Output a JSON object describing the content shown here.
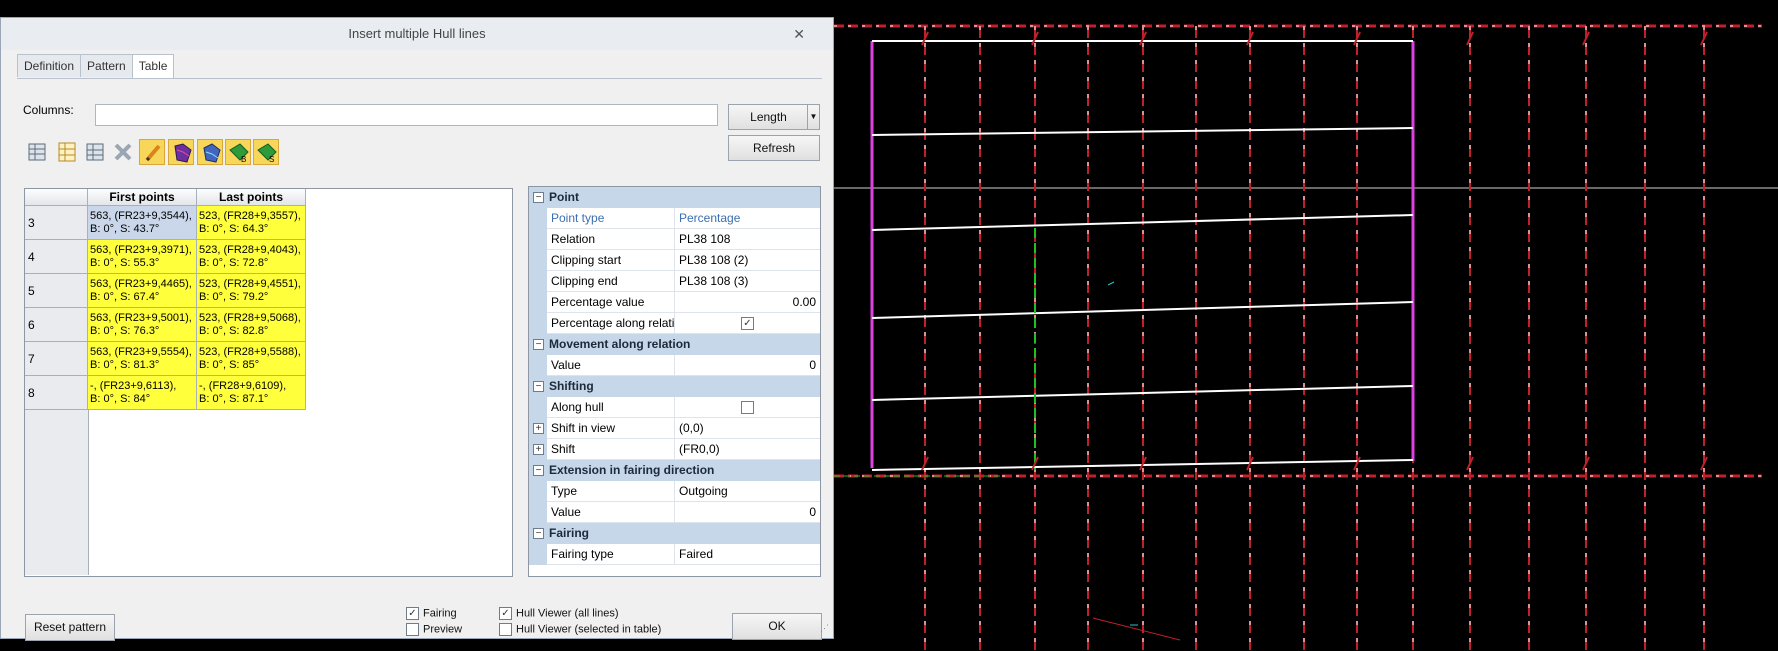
{
  "window": {
    "title": "Insert multiple Hull lines"
  },
  "tabs": [
    "Definition",
    "Pattern",
    "Table"
  ],
  "columns": {
    "label": "Columns:",
    "value": ""
  },
  "buttons": {
    "length": "Length",
    "refresh": "Refresh",
    "reset": "Reset pattern",
    "ok": "OK"
  },
  "toolbar_icons": [
    "insert-rows-icon",
    "insert-columns-icon",
    "delete-rows-icon",
    "delete-icon",
    "edit-pencil-icon",
    "hull-view-icon",
    "hull-view-alt-icon",
    "export-b-icon",
    "export-s-icon"
  ],
  "grid": {
    "headers": [
      "First points",
      "Last points"
    ],
    "rows": [
      {
        "id": "3",
        "first": [
          "563, (FR23+9,3544),",
          "B: 0°, S: 43.7°"
        ],
        "last": [
          "523, (FR28+9,3557),",
          "B: 0°, S: 64.3°"
        ]
      },
      {
        "id": "4",
        "first": [
          "563, (FR23+9,3971),",
          "B: 0°, S: 55.3°"
        ],
        "last": [
          "523, (FR28+9,4043),",
          "B: 0°, S: 72.8°"
        ]
      },
      {
        "id": "5",
        "first": [
          "563, (FR23+9,4465),",
          "B: 0°, S: 67.4°"
        ],
        "last": [
          "523, (FR28+9,4551),",
          "B: 0°, S: 79.2°"
        ]
      },
      {
        "id": "6",
        "first": [
          "563, (FR23+9,5001),",
          "B: 0°, S: 76.3°"
        ],
        "last": [
          "523, (FR28+9,5068),",
          "B: 0°, S: 82.8°"
        ]
      },
      {
        "id": "7",
        "first": [
          "563, (FR23+9,5554),",
          "B: 0°, S: 81.3°"
        ],
        "last": [
          "523, (FR28+9,5588),",
          "B: 0°, S: 85°"
        ]
      },
      {
        "id": "8",
        "first": [
          "-, (FR23+9,6113),",
          "B: 0°, S: 84°"
        ],
        "last": [
          "-, (FR28+9,6109),",
          "B: 0°, S: 87.1°"
        ]
      }
    ]
  },
  "properties": [
    {
      "type": "section",
      "label": "Point",
      "sign": "⊟"
    },
    {
      "type": "prop",
      "name": "Point type",
      "value": "Percentage",
      "style": "blue"
    },
    {
      "type": "prop",
      "name": "Relation",
      "value": "PL38 108"
    },
    {
      "type": "prop",
      "name": "Clipping start",
      "value": "PL38 108 (2)"
    },
    {
      "type": "prop",
      "name": "Clipping end",
      "value": "PL38 108 (3)"
    },
    {
      "type": "prop",
      "name": "Percentage value",
      "value": "0.00",
      "align": "num"
    },
    {
      "type": "check",
      "name": "Percentage along relatio",
      "checked": true
    },
    {
      "type": "section",
      "label": "Movement along relation",
      "sign": "⊟"
    },
    {
      "type": "prop",
      "name": "Value",
      "value": "0",
      "align": "num"
    },
    {
      "type": "section",
      "label": "Shifting",
      "sign": "⊟"
    },
    {
      "type": "check",
      "name": "Along hull",
      "checked": false
    },
    {
      "type": "prop",
      "name": "Shift in view",
      "value": "(0,0)",
      "expand": true
    },
    {
      "type": "prop",
      "name": "Shift",
      "value": "(FR0,0)",
      "expand": true
    },
    {
      "type": "section",
      "label": "Extension in fairing direction",
      "sign": "⊟"
    },
    {
      "type": "prop",
      "name": "Type",
      "value": "Outgoing"
    },
    {
      "type": "prop",
      "name": "Value",
      "value": "0",
      "align": "num"
    },
    {
      "type": "section",
      "label": "Fairing",
      "sign": "⊟"
    },
    {
      "type": "prop",
      "name": "Fairing type",
      "value": "Faired"
    }
  ],
  "options": {
    "fairing": {
      "label": "Fairing",
      "checked": true
    },
    "preview": {
      "label": "Preview",
      "checked": false
    },
    "hull_all": {
      "label": "Hull Viewer (all lines)",
      "checked": true
    },
    "hull_sel": {
      "label": "Hull Viewer (selected in table)",
      "checked": false
    }
  },
  "colors": {
    "magenta": "#e040e0",
    "grid_red": "#c0202a",
    "green": "#22c022",
    "cyan": "#30c0d0"
  }
}
